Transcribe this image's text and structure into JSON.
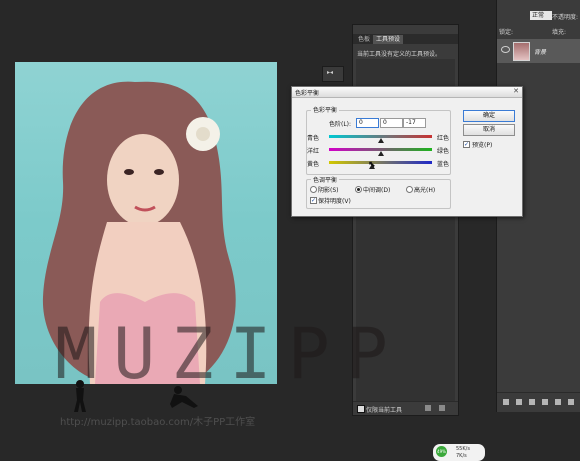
{
  "tool_presets_panel": {
    "tabs": [
      "色板",
      "工具预设"
    ],
    "active_tab": "工具预设",
    "message": "当前工具没有定义的工具预设。",
    "footer_checkbox_label": "仅限当前工具"
  },
  "layers_panel": {
    "blend_mode": "正常",
    "opacity_label": "不透明度:",
    "lock_label": "锁定:",
    "fill_label": "填充:",
    "layer_name": "背景"
  },
  "dialog": {
    "title": "色彩平衡",
    "color_balance_group": "色彩平衡",
    "levels_label": "色阶(L):",
    "levels": [
      "0",
      "0",
      "-17"
    ],
    "sliders": [
      {
        "left": "青色",
        "right": "红色",
        "value": 0
      },
      {
        "left": "洋红",
        "right": "绿色",
        "value": 0
      },
      {
        "left": "黄色",
        "right": "蓝色",
        "value": -17
      }
    ],
    "tone_balance_group": "色调平衡",
    "tones": [
      "阴影(S)",
      "中间调(D)",
      "高光(H)"
    ],
    "selected_tone": "中间调(D)",
    "preserve_luminosity": "保持明度(V)",
    "preserve_checked": true,
    "ok_label": "确定",
    "cancel_label": "取消",
    "preview_label": "预览(P)",
    "preview_checked": true
  },
  "watermark": {
    "text": "MUZIPP",
    "url": "http://muzipp.taobao.com/木子PP工作室"
  },
  "speed_badge": {
    "percent": "49%",
    "up": "55K/s",
    "down": "7K/s"
  }
}
